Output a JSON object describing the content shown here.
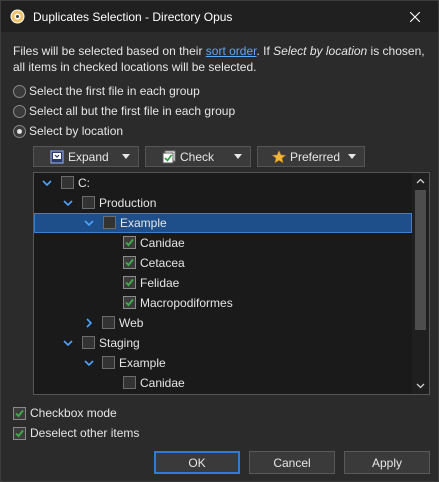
{
  "window": {
    "title": "Duplicates Selection - Directory Opus"
  },
  "description": {
    "part1": "Files will be selected based on their ",
    "link": "sort order",
    "part2": ". If ",
    "italic": "Select by location",
    "part3": " is chosen, all items in checked locations will be selected."
  },
  "radios": [
    {
      "label": "Select the first file in each group",
      "selected": false
    },
    {
      "label": "Select all but the first file in each group",
      "selected": false
    },
    {
      "label": "Select by location",
      "selected": true
    }
  ],
  "toolbar": {
    "expand_label": "Expand",
    "check_label": "Check",
    "preferred_label": "Preferred"
  },
  "tree": [
    {
      "label": "C:",
      "checked": false,
      "expanded": true,
      "selected": false
    },
    {
      "label": "Production",
      "checked": false,
      "expanded": true,
      "selected": false
    },
    {
      "label": "Example",
      "checked": false,
      "expanded": true,
      "selected": true
    },
    {
      "label": "Canidae",
      "checked": true,
      "selected": false
    },
    {
      "label": "Cetacea",
      "checked": true,
      "selected": false
    },
    {
      "label": "Felidae",
      "checked": true,
      "selected": false
    },
    {
      "label": "Macropodiformes",
      "checked": true,
      "selected": false
    },
    {
      "label": "Web",
      "checked": false,
      "expanded": false,
      "selected": false
    },
    {
      "label": "Staging",
      "checked": false,
      "expanded": true,
      "selected": false
    },
    {
      "label": "Example",
      "checked": false,
      "expanded": true,
      "selected": false
    },
    {
      "label": "Canidae",
      "checked": false,
      "selected": false
    }
  ],
  "options": {
    "checkbox_mode": {
      "label": "Checkbox mode",
      "checked": true
    },
    "deselect_other": {
      "label": "Deselect other items",
      "checked": true
    }
  },
  "buttons": {
    "ok": "OK",
    "cancel": "Cancel",
    "apply": "Apply"
  },
  "colors": {
    "accent": "#2f7bd6",
    "selection": "#1e4f8a",
    "link": "#5ca7ff",
    "check": "#3fae49"
  }
}
